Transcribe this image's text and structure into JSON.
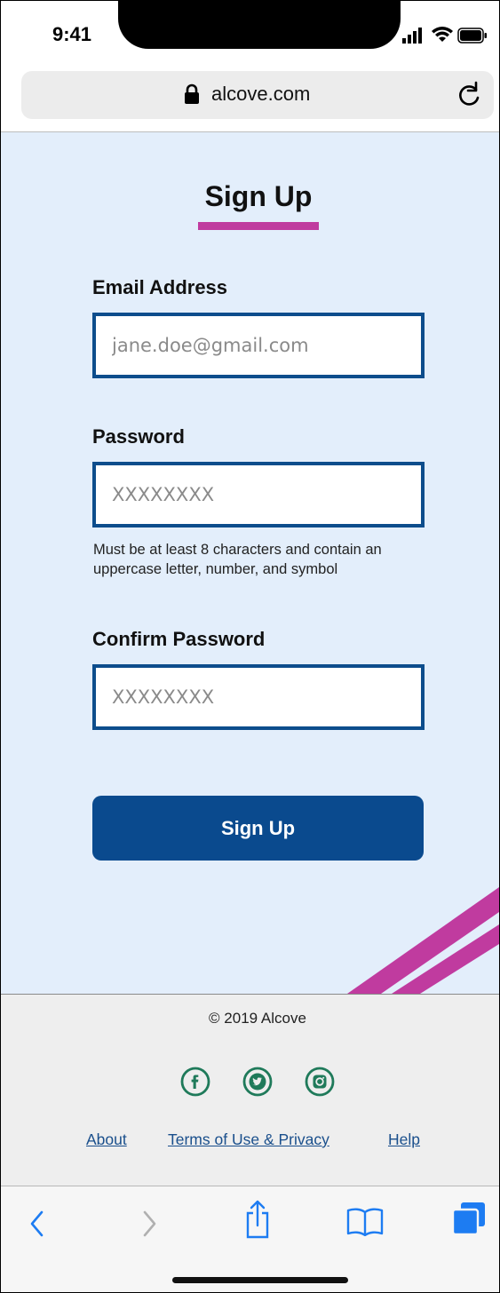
{
  "status_bar": {
    "time": "9:41"
  },
  "browser": {
    "url": "alcove.com"
  },
  "form": {
    "title": "Sign Up",
    "email": {
      "label": "Email Address",
      "placeholder": "jane.doe@gmail.com"
    },
    "password": {
      "label": "Password",
      "placeholder": "XXXXXXXX",
      "hint": "Must be at least 8 characters and contain an uppercase letter, number, and symbol"
    },
    "confirm": {
      "label": "Confirm Password",
      "placeholder": "XXXXXXXX"
    },
    "submit_label": "Sign Up"
  },
  "footer": {
    "copyright": "© 2019 Alcove",
    "social_icons": [
      "facebook-icon",
      "twitter-icon",
      "instagram-icon"
    ],
    "links": [
      "About",
      "Terms of Use & Privacy",
      "Help"
    ]
  },
  "toolbar": {
    "icons": [
      "back-icon",
      "forward-icon",
      "share-icon",
      "bookmarks-icon",
      "tabs-icon"
    ]
  },
  "colors": {
    "accent": "#c03b9f",
    "primary": "#0a4a8e",
    "link": "#1a4f8c",
    "social": "#1f7a5a",
    "ios_blue": "#1d7cf2",
    "background": "#e3eefb"
  }
}
